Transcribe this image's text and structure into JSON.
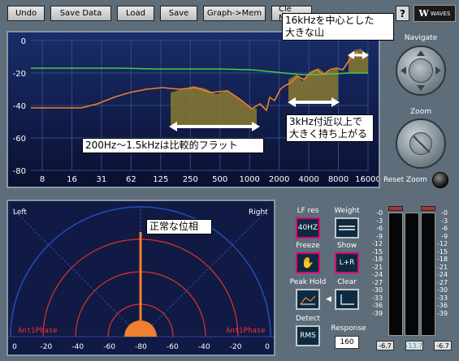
{
  "toolbar": {
    "buttons": [
      "Undo",
      "Save Data",
      "Load",
      "Save",
      "Graph->Mem",
      "Cl"
    ],
    "clear_suffix": "e Mem",
    "help": "?",
    "logo": "WAVES"
  },
  "spectrum": {
    "y_ticks": [
      "0",
      "-20",
      "-40",
      "-60",
      "-80"
    ],
    "x_ticks": [
      "8",
      "16",
      "31",
      "62",
      "125",
      "250",
      "500",
      "1000",
      "2000",
      "4000",
      "8000",
      "16000"
    ]
  },
  "navigator": {
    "navigate_label": "Navigate",
    "zoom_label": "Zoom",
    "reset_zoom_label": "Reset Zoom"
  },
  "phase": {
    "left_label": "Left",
    "right_label": "Right",
    "antiphase_left": "AntiPhase",
    "antiphase_right": "AntiPhase",
    "x_ticks": [
      "0",
      "-20",
      "-40",
      "-60",
      "-80",
      "-60",
      "-40",
      "-20",
      "0"
    ]
  },
  "controls": {
    "lf_res_label": "LF res",
    "lf_res_value": "40HZ",
    "weight_label": "Weight",
    "freeze_label": "Freeze",
    "show_label": "Show",
    "show_value": "L+R",
    "peak_hold_label": "Peak Hold",
    "clear_label": "Clear",
    "detect_label": "Detect",
    "detect_value": "RMS",
    "response_label": "Response",
    "response_value": "160"
  },
  "meters": {
    "scale": [
      "-0",
      "-3",
      "-6",
      "-9",
      "-12",
      "-15",
      "-18",
      "-21",
      "-24",
      "-27",
      "-30",
      "-33",
      "-36",
      "-39"
    ],
    "peaks": [
      "-6.7",
      "-13.7",
      "-6.7"
    ]
  },
  "annotations": {
    "peak_note_1": "16kHzを中心とした",
    "peak_note_2": "大きな山",
    "rise_note_1": "3kHz付近以上で",
    "rise_note_2": "大きく持ち上がる",
    "flat_note": "200Hz〜1.5kHzは比較的フラット",
    "phase_note": "正常な位相"
  },
  "colors": {
    "accent_orange": "#f08030",
    "green_curve": "#40d040",
    "highlight_olive": "#8a7a30",
    "callout_bg": "#ffffff"
  }
}
